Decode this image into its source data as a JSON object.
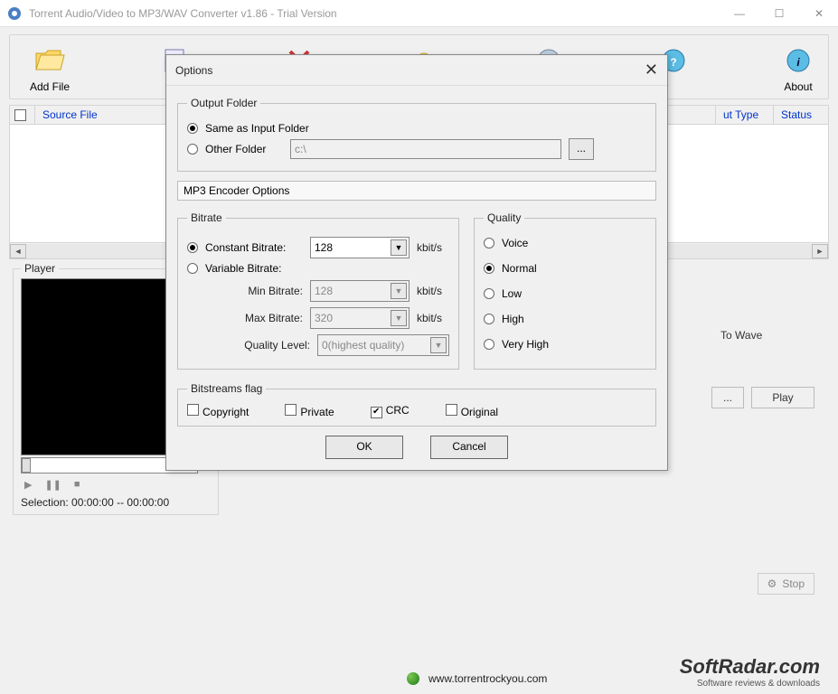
{
  "window": {
    "title": "Torrent Audio/Video to MP3/WAV Converter v1.86 - Trial Version"
  },
  "toolbar": {
    "add_file": "Add File",
    "about": "About"
  },
  "list": {
    "source_file": "Source File",
    "out_type": "ut Type",
    "status": "Status"
  },
  "player": {
    "title": "Player",
    "selection": "Selection: 00:00:00 -- 00:00:00"
  },
  "right": {
    "to_wave": "To Wave",
    "browse": "...",
    "play": "Play",
    "stop": "Stop"
  },
  "dialog": {
    "title": "Options",
    "output_folder": {
      "legend": "Output Folder",
      "same_as_input": "Same as Input Folder",
      "other_folder": "Other Folder",
      "path": "c:\\",
      "browse": "..."
    },
    "mp3_section": "MP3 Encoder Options",
    "bitrate": {
      "legend": "Bitrate",
      "constant": "Constant Bitrate:",
      "variable": "Variable Bitrate:",
      "value": "128",
      "unit": "kbit/s",
      "min_label": "Min Bitrate:",
      "min_value": "128",
      "max_label": "Max Bitrate:",
      "max_value": "320",
      "quality_label": "Quality Level:",
      "quality_value": "0(highest quality)"
    },
    "quality": {
      "legend": "Quality",
      "voice": "Voice",
      "normal": "Normal",
      "low": "Low",
      "high": "High",
      "very_high": "Very High"
    },
    "bitstreams": {
      "legend": "Bitstreams flag",
      "copyright": "Copyright",
      "private": "Private",
      "crc": "CRC",
      "original": "Original"
    },
    "ok": "OK",
    "cancel": "Cancel"
  },
  "footer": {
    "url": "www.torrentrockyou.com",
    "softradar": "SoftRadar.com",
    "softradar_sub": "Software reviews & downloads"
  }
}
